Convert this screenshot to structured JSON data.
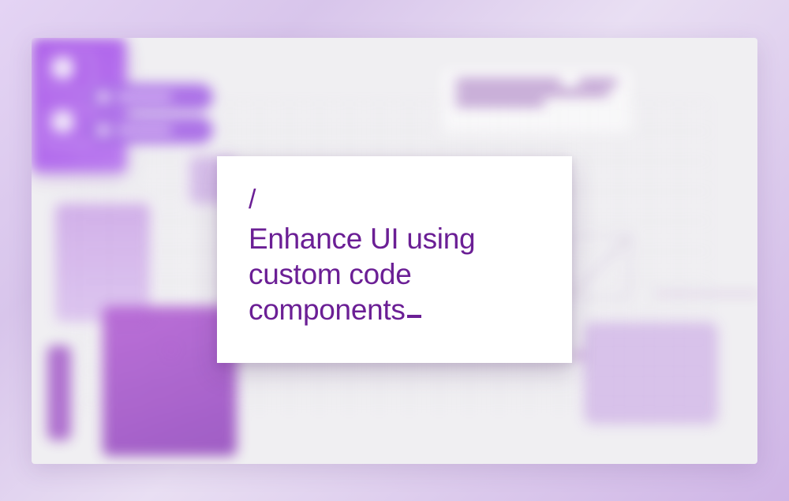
{
  "card": {
    "slash": "/",
    "title_line1": "Enhance UI using",
    "title_line2": "custom code",
    "title_line3": "components"
  },
  "colors": {
    "brand_purple": "#6b1f95",
    "accent_violet": "#a44ce8",
    "lavender": "#c89de6"
  }
}
